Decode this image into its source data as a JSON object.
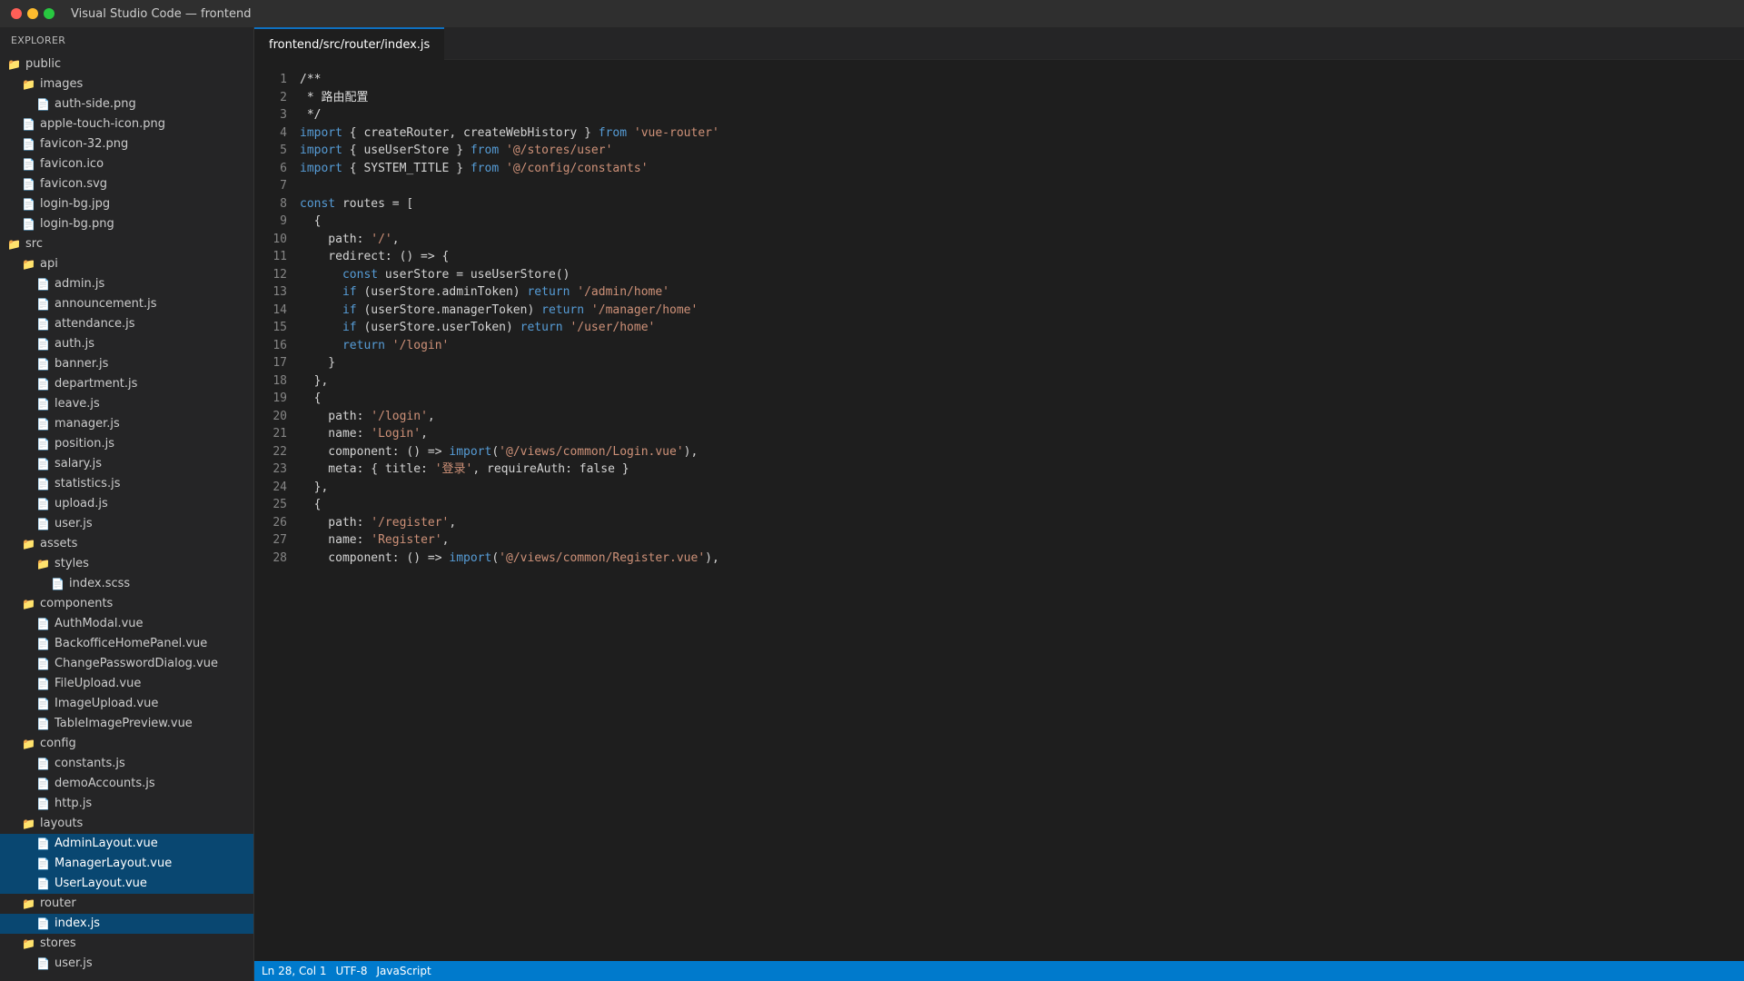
{
  "window": {
    "title": "Visual Studio Code — frontend"
  },
  "sidebar": {
    "header": "EXPLORER",
    "items": [
      {
        "label": "public",
        "type": "folder",
        "depth": 0
      },
      {
        "label": "images",
        "type": "folder",
        "depth": 1
      },
      {
        "label": "auth-side.png",
        "type": "file",
        "depth": 2
      },
      {
        "label": "apple-touch-icon.png",
        "type": "file",
        "depth": 1
      },
      {
        "label": "favicon-32.png",
        "type": "file",
        "depth": 1
      },
      {
        "label": "favicon.ico",
        "type": "file",
        "depth": 1
      },
      {
        "label": "favicon.svg",
        "type": "file",
        "depth": 1
      },
      {
        "label": "login-bg.jpg",
        "type": "file",
        "depth": 1
      },
      {
        "label": "login-bg.png",
        "type": "file",
        "depth": 1
      },
      {
        "label": "src",
        "type": "folder",
        "depth": 0
      },
      {
        "label": "api",
        "type": "folder",
        "depth": 1
      },
      {
        "label": "admin.js",
        "type": "file",
        "depth": 2
      },
      {
        "label": "announcement.js",
        "type": "file",
        "depth": 2
      },
      {
        "label": "attendance.js",
        "type": "file",
        "depth": 2
      },
      {
        "label": "auth.js",
        "type": "file",
        "depth": 2
      },
      {
        "label": "banner.js",
        "type": "file",
        "depth": 2
      },
      {
        "label": "department.js",
        "type": "file",
        "depth": 2
      },
      {
        "label": "leave.js",
        "type": "file",
        "depth": 2
      },
      {
        "label": "manager.js",
        "type": "file",
        "depth": 2
      },
      {
        "label": "position.js",
        "type": "file",
        "depth": 2
      },
      {
        "label": "salary.js",
        "type": "file",
        "depth": 2
      },
      {
        "label": "statistics.js",
        "type": "file",
        "depth": 2
      },
      {
        "label": "upload.js",
        "type": "file",
        "depth": 2
      },
      {
        "label": "user.js",
        "type": "file",
        "depth": 2
      },
      {
        "label": "assets",
        "type": "folder",
        "depth": 1
      },
      {
        "label": "styles",
        "type": "folder",
        "depth": 2
      },
      {
        "label": "index.scss",
        "type": "file",
        "depth": 3
      },
      {
        "label": "components",
        "type": "folder",
        "depth": 1
      },
      {
        "label": "AuthModal.vue",
        "type": "file",
        "depth": 2
      },
      {
        "label": "BackofficeHomePanel.vue",
        "type": "file",
        "depth": 2
      },
      {
        "label": "ChangePasswordDialog.vue",
        "type": "file",
        "depth": 2
      },
      {
        "label": "FileUpload.vue",
        "type": "file",
        "depth": 2
      },
      {
        "label": "ImageUpload.vue",
        "type": "file",
        "depth": 2
      },
      {
        "label": "TableImagePreview.vue",
        "type": "file",
        "depth": 2
      },
      {
        "label": "config",
        "type": "folder",
        "depth": 1
      },
      {
        "label": "constants.js",
        "type": "file",
        "depth": 2
      },
      {
        "label": "demoAccounts.js",
        "type": "file",
        "depth": 2
      },
      {
        "label": "http.js",
        "type": "file",
        "depth": 2
      },
      {
        "label": "layouts",
        "type": "folder",
        "depth": 1
      },
      {
        "label": "AdminLayout.vue",
        "type": "file",
        "depth": 2,
        "selected": true
      },
      {
        "label": "ManagerLayout.vue",
        "type": "file",
        "depth": 2,
        "selected": true
      },
      {
        "label": "UserLayout.vue",
        "type": "file",
        "depth": 2,
        "selected": true
      },
      {
        "label": "router",
        "type": "folder",
        "depth": 1
      },
      {
        "label": "index.js",
        "type": "file",
        "depth": 2,
        "selected": true
      },
      {
        "label": "stores",
        "type": "folder",
        "depth": 1
      },
      {
        "label": "user.js",
        "type": "file",
        "depth": 2
      }
    ]
  },
  "tabs": [
    {
      "label": "frontend/src/router/index.js",
      "active": true
    }
  ],
  "editor": {
    "lines": [
      {
        "n": "1",
        "tokens": [
          {
            "t": "/**",
            "c": "cmt"
          }
        ]
      },
      {
        "n": "2",
        "tokens": [
          {
            "t": " * 路由配置",
            "c": "cmt"
          }
        ]
      },
      {
        "n": "3",
        "tokens": [
          {
            "t": " */",
            "c": "cmt"
          }
        ]
      },
      {
        "n": "4",
        "tokens": [
          {
            "t": "import",
            "c": "kw"
          },
          {
            "t": " { createRouter, createWebHistory } ",
            "c": ""
          },
          {
            "t": "from",
            "c": "kw"
          },
          {
            "t": " ",
            "c": ""
          },
          {
            "t": "'vue-router'",
            "c": "str"
          }
        ]
      },
      {
        "n": "5",
        "tokens": [
          {
            "t": "import",
            "c": "kw"
          },
          {
            "t": " { useUserStore } ",
            "c": ""
          },
          {
            "t": "from",
            "c": "kw"
          },
          {
            "t": " ",
            "c": ""
          },
          {
            "t": "'@/stores/user'",
            "c": "str"
          }
        ]
      },
      {
        "n": "6",
        "tokens": [
          {
            "t": "import",
            "c": "kw"
          },
          {
            "t": " { SYSTEM_TITLE } ",
            "c": ""
          },
          {
            "t": "from",
            "c": "kw"
          },
          {
            "t": " ",
            "c": ""
          },
          {
            "t": "'@/config/constants'",
            "c": "str"
          }
        ]
      },
      {
        "n": "7",
        "tokens": [
          {
            "t": "",
            "c": ""
          }
        ]
      },
      {
        "n": "8",
        "tokens": [
          {
            "t": "const",
            "c": "kw"
          },
          {
            "t": " routes = [",
            "c": ""
          }
        ]
      },
      {
        "n": "9",
        "tokens": [
          {
            "t": "  {",
            "c": ""
          }
        ]
      },
      {
        "n": "10",
        "tokens": [
          {
            "t": "    path: ",
            "c": ""
          },
          {
            "t": "'/'",
            "c": "str"
          },
          {
            "t": ",",
            "c": ""
          }
        ]
      },
      {
        "n": "11",
        "tokens": [
          {
            "t": "    redirect: () => {",
            "c": ""
          }
        ]
      },
      {
        "n": "12",
        "tokens": [
          {
            "t": "      ",
            "c": ""
          },
          {
            "t": "const",
            "c": "kw"
          },
          {
            "t": " userStore = useUserStore()",
            "c": ""
          }
        ]
      },
      {
        "n": "13",
        "tokens": [
          {
            "t": "      ",
            "c": ""
          },
          {
            "t": "if",
            "c": "kw"
          },
          {
            "t": " (userStore.adminToken) ",
            "c": ""
          },
          {
            "t": "return",
            "c": "kw"
          },
          {
            "t": " ",
            "c": ""
          },
          {
            "t": "'/admin/home'",
            "c": "str"
          }
        ]
      },
      {
        "n": "14",
        "tokens": [
          {
            "t": "      ",
            "c": ""
          },
          {
            "t": "if",
            "c": "kw"
          },
          {
            "t": " (userStore.managerToken) ",
            "c": ""
          },
          {
            "t": "return",
            "c": "kw"
          },
          {
            "t": " ",
            "c": ""
          },
          {
            "t": "'/manager/home'",
            "c": "str"
          }
        ]
      },
      {
        "n": "15",
        "tokens": [
          {
            "t": "      ",
            "c": ""
          },
          {
            "t": "if",
            "c": "kw"
          },
          {
            "t": " (userStore.userToken) ",
            "c": ""
          },
          {
            "t": "return",
            "c": "kw"
          },
          {
            "t": " ",
            "c": ""
          },
          {
            "t": "'/user/home'",
            "c": "str"
          }
        ]
      },
      {
        "n": "16",
        "tokens": [
          {
            "t": "      ",
            "c": ""
          },
          {
            "t": "return",
            "c": "kw"
          },
          {
            "t": " ",
            "c": ""
          },
          {
            "t": "'/login'",
            "c": "str"
          }
        ]
      },
      {
        "n": "17",
        "tokens": [
          {
            "t": "    }",
            "c": ""
          }
        ]
      },
      {
        "n": "18",
        "tokens": [
          {
            "t": "  },",
            "c": ""
          }
        ]
      },
      {
        "n": "19",
        "tokens": [
          {
            "t": "  {",
            "c": ""
          }
        ]
      },
      {
        "n": "20",
        "tokens": [
          {
            "t": "    path: ",
            "c": ""
          },
          {
            "t": "'/login'",
            "c": "str"
          },
          {
            "t": ",",
            "c": ""
          }
        ]
      },
      {
        "n": "21",
        "tokens": [
          {
            "t": "    name: ",
            "c": ""
          },
          {
            "t": "'Login'",
            "c": "str"
          },
          {
            "t": ",",
            "c": ""
          }
        ]
      },
      {
        "n": "22",
        "tokens": [
          {
            "t": "    component: () => ",
            "c": ""
          },
          {
            "t": "import",
            "c": "kw"
          },
          {
            "t": "(",
            "c": ""
          },
          {
            "t": "'@/views/common/Login.vue'",
            "c": "str"
          },
          {
            "t": "),",
            "c": ""
          }
        ]
      },
      {
        "n": "23",
        "tokens": [
          {
            "t": "    meta: { title: ",
            "c": ""
          },
          {
            "t": "'登录'",
            "c": "str"
          },
          {
            "t": ", requireAuth: false }",
            "c": ""
          }
        ]
      },
      {
        "n": "24",
        "tokens": [
          {
            "t": "  },",
            "c": ""
          }
        ]
      },
      {
        "n": "25",
        "tokens": [
          {
            "t": "  {",
            "c": ""
          }
        ]
      },
      {
        "n": "26",
        "tokens": [
          {
            "t": "    path: ",
            "c": ""
          },
          {
            "t": "'/register'",
            "c": "str"
          },
          {
            "t": ",",
            "c": ""
          }
        ]
      },
      {
        "n": "27",
        "tokens": [
          {
            "t": "    name: ",
            "c": ""
          },
          {
            "t": "'Register'",
            "c": "str"
          },
          {
            "t": ",",
            "c": ""
          }
        ]
      },
      {
        "n": "28",
        "tokens": [
          {
            "t": "    component: () => ",
            "c": ""
          },
          {
            "t": "import",
            "c": "kw"
          },
          {
            "t": "(",
            "c": ""
          },
          {
            "t": "'@/views/common/Register.vue'",
            "c": "str"
          },
          {
            "t": "),",
            "c": ""
          }
        ]
      }
    ]
  },
  "statusbar": {
    "position": "Ln 28, Col 1",
    "encoding": "UTF-8",
    "language": "JavaScript"
  },
  "colors": {
    "accent": "#007acc",
    "selection": "#094771",
    "keyword": "#569cd6",
    "string": "#ce9178"
  },
  "icons": {
    "folder": "folder-icon",
    "file": "file-icon"
  }
}
